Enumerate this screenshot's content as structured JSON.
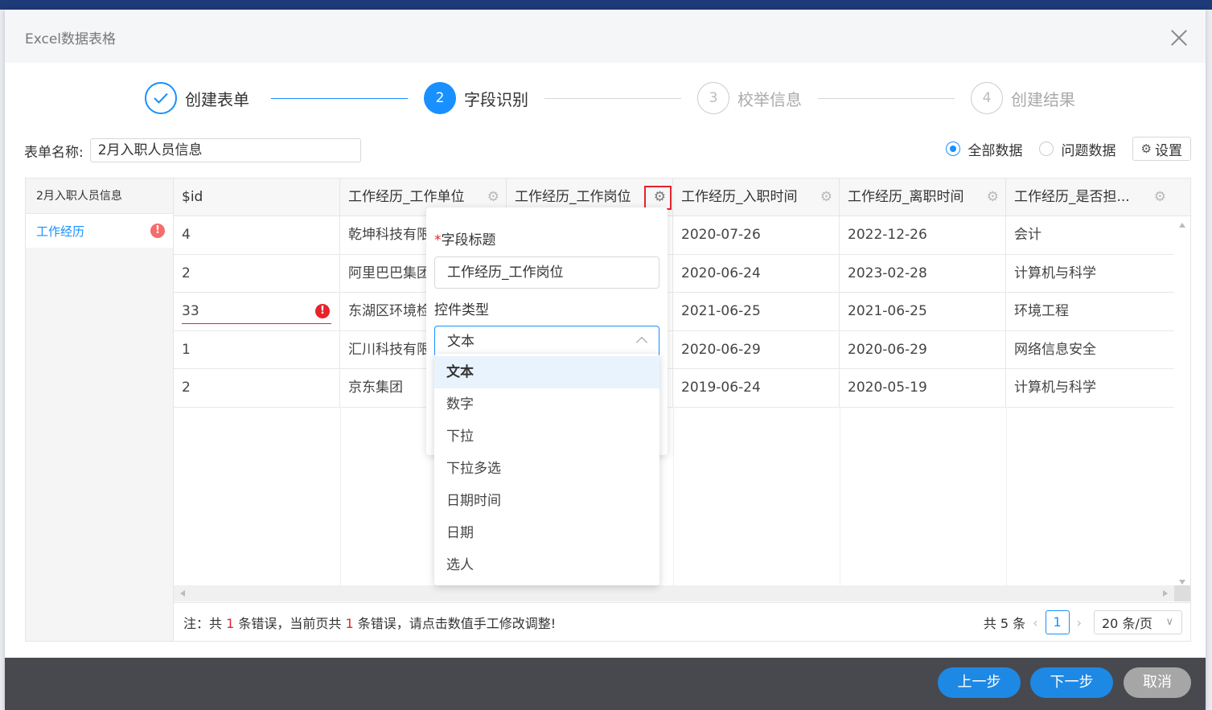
{
  "modal": {
    "title": "Excel数据表格"
  },
  "steps": [
    {
      "num": "",
      "label": "创建表单",
      "state": "done"
    },
    {
      "num": "2",
      "label": "字段识别",
      "state": "active"
    },
    {
      "num": "3",
      "label": "校举信息",
      "state": "wait"
    },
    {
      "num": "4",
      "label": "创建结果",
      "state": "wait"
    }
  ],
  "form": {
    "name_label": "表单名称:",
    "name_value": "2月入职人员信息"
  },
  "filter": {
    "all_label": "全部数据",
    "problem_label": "问题数据",
    "settings_label": "设置"
  },
  "sidebar": {
    "header": "2月入职人员信息",
    "items": [
      {
        "label": "工作经历",
        "badge": "!"
      }
    ]
  },
  "table": {
    "columns": [
      "$id",
      "工作经历_工作单位",
      "工作经历_工作岗位",
      "工作经历_入职时间",
      "工作经历_离职时间",
      "工作经历_是否担..."
    ],
    "rows": [
      [
        "4",
        "乾坤科技有限",
        "",
        "2020-07-26",
        "2022-12-26",
        "会计"
      ],
      [
        "2",
        "阿里巴巴集团",
        "",
        "2020-06-24",
        "2023-02-28",
        "计算机与科学"
      ],
      [
        "33",
        "东湖区环境检",
        "",
        "2021-06-25",
        "2021-06-25",
        "环境工程"
      ],
      [
        "1",
        "汇川科技有限",
        "",
        "2020-06-29",
        "2020-06-29",
        "网络信息安全"
      ],
      [
        "2",
        "京东集团",
        "",
        "2019-06-24",
        "2020-05-19",
        "计算机与科学"
      ]
    ]
  },
  "footer": {
    "note_a": "注：共 ",
    "count_a": "1",
    "note_b": " 条错误，当前页共 ",
    "count_b": "1",
    "note_c": " 条错误，请点击数值手工修改调整!",
    "total": "共 5 条",
    "page": "1",
    "page_size": "20 条/页"
  },
  "popover": {
    "title_label": "字段标题",
    "title_value": "工作经历_工作岗位",
    "type_label": "控件类型",
    "type_value": "文本"
  },
  "dropdown": {
    "options": [
      "文本",
      "数字",
      "下拉",
      "下拉多选",
      "日期时间",
      "日期",
      "选人"
    ],
    "selected": 0
  },
  "actions": {
    "prev": "上一步",
    "next": "下一步",
    "cancel": "取消"
  },
  "colors": {
    "primary": "#1890ff",
    "error": "#e5242b",
    "cancel": "#a6a6a6"
  }
}
